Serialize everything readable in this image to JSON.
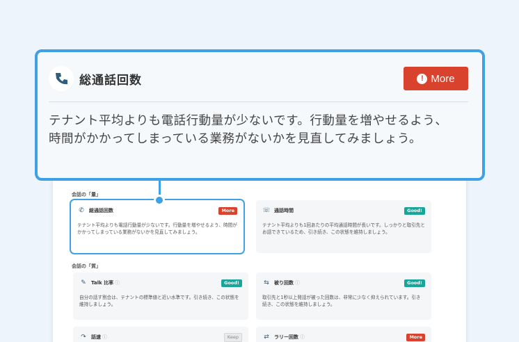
{
  "callout": {
    "icon": "phone-icon",
    "title": "総通話回数",
    "more_label": "More",
    "body": "テナント平均よりも電話行動量が少ないです。行動量を増やせるよう、時間がかかってしまっている業務がないかを見直してみましょう。"
  },
  "sections": {
    "quantity_label": "会話の「量」",
    "quality_label": "会話の「質」"
  },
  "cards": [
    {
      "icon": "phone-icon",
      "title": "総通話回数",
      "badge": "More",
      "text": "テナント平均よりも電話行動量が少ないです。行動量を増やせるよう、時間がかかってしまっている業務がないかを見直してみましょう。"
    },
    {
      "icon": "phone-time-icon",
      "title": "通話時間",
      "badge": "Good!",
      "text": "テナント平均よりも1回あたりの平均通話時間が長いです。しっかりと取引先とお話できているため、引き続き、この状態を維持しましょう。"
    },
    {
      "icon": "talk-ratio-icon",
      "title": "Talk 比率",
      "badge": "Good!",
      "text": "自分の話す割合は、テナントの標準値と近い水準です。引き続き、この状態を維持しましょう。"
    },
    {
      "icon": "overlap-icon",
      "title": "被り回数",
      "badge": "Good!",
      "text": "取引先と1秒以上発話が被った回数は、非常に少なく抑えられています。引き続き、この状態を維持しましょう。"
    },
    {
      "icon": "speed-icon",
      "title": "話速",
      "badge": "Keep",
      "text": ""
    },
    {
      "icon": "rally-icon",
      "title": "ラリー回数",
      "badge": "More",
      "text": ""
    }
  ],
  "colors": {
    "accent": "#3ea1e6",
    "more": "#d9432e",
    "good": "#1aa59a"
  }
}
